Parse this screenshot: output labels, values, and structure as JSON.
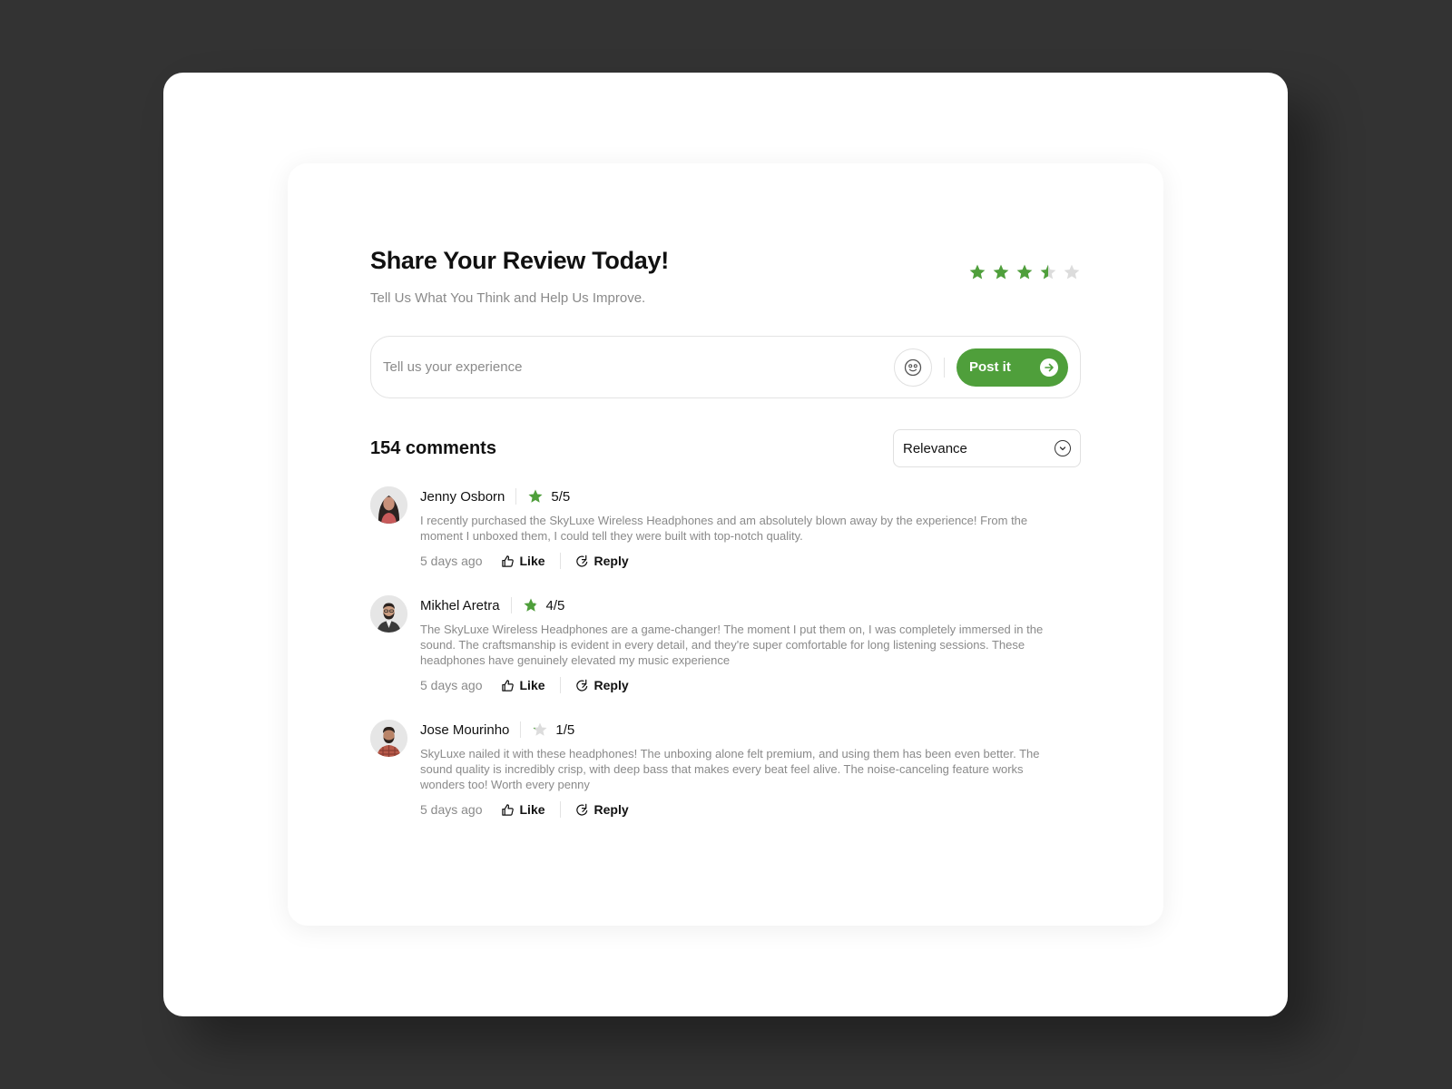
{
  "review": {
    "title": "Share Your Review Today!",
    "subtitle": "Tell Us What You Think and Help Us Improve.",
    "rating": 3.5,
    "max_rating": 5
  },
  "composer": {
    "placeholder": "Tell us your experience",
    "value": "",
    "emoji_icon": "smiley-icon",
    "post_label": "Post it",
    "post_icon": "arrow-right-circle-icon"
  },
  "comments_section": {
    "count_label": "154 comments",
    "sort": {
      "selected": "Relevance",
      "icon": "chevron-down-icon"
    }
  },
  "comments": [
    {
      "name": "Jenny Osborn",
      "rating_label": "5/5",
      "rating": 5,
      "text": "I recently purchased the SkyLuxe Wireless Headphones and am absolutely blown away by the experience! From the moment I unboxed them, I could tell they were built with top-notch quality.",
      "time": "5 days ago",
      "like_label": "Like",
      "reply_label": "Reply"
    },
    {
      "name": "Mikhel Aretra",
      "rating_label": "4/5",
      "rating": 4,
      "text": "The SkyLuxe Wireless Headphones are a game-changer! The moment I put them on, I was completely immersed in the sound. The craftsmanship is evident in every detail, and they're super comfortable for long listening sessions. These headphones have genuinely elevated my music experience",
      "time": "5 days ago",
      "like_label": "Like",
      "reply_label": "Reply"
    },
    {
      "name": "Jose Mourinho",
      "rating_label": "1/5",
      "rating": 1,
      "text": "SkyLuxe nailed it with these headphones! The unboxing alone felt premium, and using them has been even better. The sound quality is incredibly crisp, with deep bass that makes every beat feel alive. The noise-canceling feature works wonders too! Worth every penny",
      "time": "5 days ago",
      "like_label": "Like",
      "reply_label": "Reply"
    }
  ],
  "colors": {
    "accent": "#4f9f3b",
    "star_empty": "#dcdcdc",
    "muted_text": "#8a8a8a",
    "background": "#333333"
  }
}
